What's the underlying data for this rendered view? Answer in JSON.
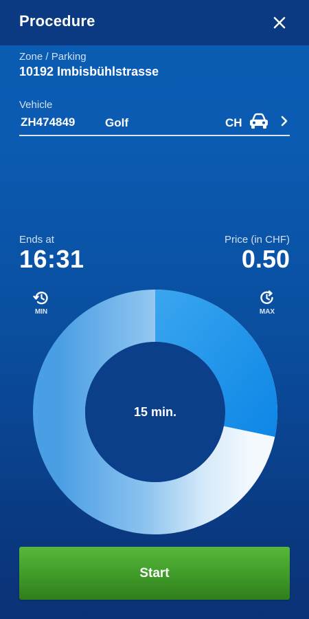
{
  "header": {
    "title": "Procedure",
    "close_icon": "close-icon"
  },
  "zone": {
    "label": "Zone / Parking",
    "value": "10192 Imbisbühlstrasse"
  },
  "vehicle": {
    "label": "Vehicle",
    "plate": "ZH474849",
    "model": "Golf",
    "country": "CH",
    "car_icon": "car-icon",
    "chevron_icon": "chevron-right-icon"
  },
  "ends_at": {
    "label": "Ends at",
    "value": "16:31"
  },
  "price": {
    "label": "Price (in CHF)",
    "value": "0.50"
  },
  "controls": {
    "min_label": "MIN",
    "max_label": "MAX",
    "min_icon": "history-icon",
    "max_icon": "update-icon"
  },
  "dial": {
    "center_text": "15 min."
  },
  "start_button": {
    "label": "Start"
  },
  "colors": {
    "header_bg": "#0b3a83",
    "background_top": "#0a5cb4",
    "background_bottom": "#0b3276",
    "start_green": "#3f9a28",
    "dial_accent": "#1a8ee8"
  }
}
